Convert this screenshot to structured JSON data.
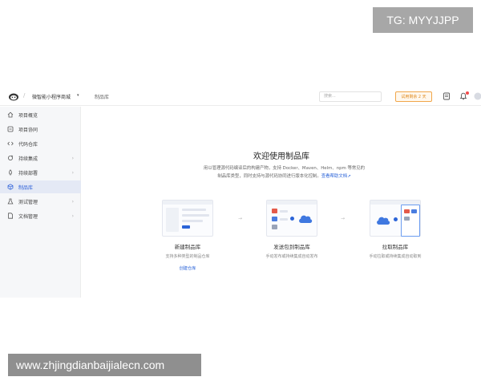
{
  "watermark": {
    "top": "TG: MYYJJPP",
    "bottom": "www.zhjingdianbaijialecn.com"
  },
  "colors": {
    "accent": "#2b64d8",
    "trial_border": "#f1a64a",
    "sidebar_bg": "#f6f7f9",
    "active_bg": "#e4e9f5",
    "notice_dot": "#f24c4c"
  },
  "topbar": {
    "logo_icon": "mascot-logo-icon",
    "app_name": "微智能小程序商城",
    "app_caret": "▾",
    "crumb_separator": "/",
    "current_crumb": "制品库",
    "search_placeholder": "搜索...",
    "trial_label": "试用剩余 2 天",
    "icons": [
      "document-icon",
      "bell-icon",
      "avatar-icon"
    ]
  },
  "sidebar": {
    "items": [
      {
        "label": "项目概览",
        "icon": "home-icon",
        "arrow": ""
      },
      {
        "label": "项目协同",
        "icon": "board-icon",
        "arrow": ""
      },
      {
        "label": "代码仓库",
        "icon": "code-icon",
        "arrow": ""
      },
      {
        "label": "持续集成",
        "icon": "loop-icon",
        "arrow": "›"
      },
      {
        "label": "持续部署",
        "icon": "rocket-icon",
        "arrow": "›"
      },
      {
        "label": "制品库",
        "icon": "package-icon",
        "arrow": ""
      },
      {
        "label": "测试管理",
        "icon": "flask-icon",
        "arrow": "›"
      },
      {
        "label": "文档管理",
        "icon": "file-icon",
        "arrow": "›"
      }
    ],
    "active_index": 5
  },
  "main": {
    "title": "欢迎使用制品库",
    "desc_line1": "用以管理源代码编译后的构建产物，支持 Docker、Maven、Helm、npm 等常见的",
    "desc_line2": "制品库类型，同时支持与源代码协同进行版本化控制。",
    "desc_link": "查看帮助文档↗",
    "arrow_glyph": "→",
    "steps": [
      {
        "label": "新建制品库",
        "sub": "支持多种类型的制品仓库",
        "action": "创建仓库"
      },
      {
        "label": "发送包到制品库",
        "sub": "手动发布或持续集成自动发布",
        "action": ""
      },
      {
        "label": "拉取制品库",
        "sub": "手动拉取或持续集成自动取到",
        "action": ""
      }
    ]
  }
}
